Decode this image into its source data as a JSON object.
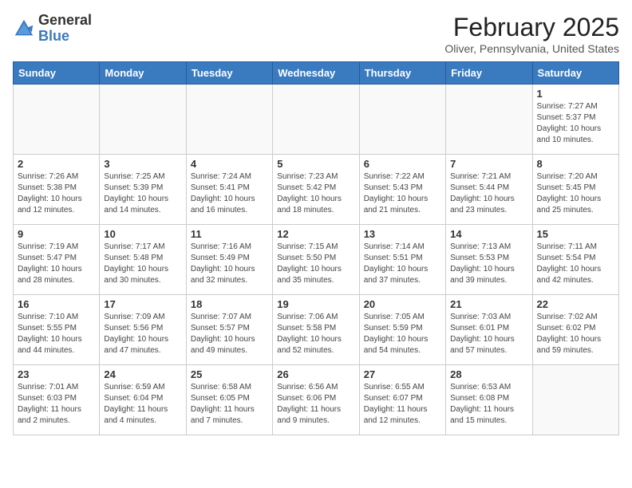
{
  "logo": {
    "general": "General",
    "blue": "Blue"
  },
  "header": {
    "month_year": "February 2025",
    "location": "Oliver, Pennsylvania, United States"
  },
  "weekdays": [
    "Sunday",
    "Monday",
    "Tuesday",
    "Wednesday",
    "Thursday",
    "Friday",
    "Saturday"
  ],
  "weeks": [
    [
      {
        "day": "",
        "info": ""
      },
      {
        "day": "",
        "info": ""
      },
      {
        "day": "",
        "info": ""
      },
      {
        "day": "",
        "info": ""
      },
      {
        "day": "",
        "info": ""
      },
      {
        "day": "",
        "info": ""
      },
      {
        "day": "1",
        "info": "Sunrise: 7:27 AM\nSunset: 5:37 PM\nDaylight: 10 hours\nand 10 minutes."
      }
    ],
    [
      {
        "day": "2",
        "info": "Sunrise: 7:26 AM\nSunset: 5:38 PM\nDaylight: 10 hours\nand 12 minutes."
      },
      {
        "day": "3",
        "info": "Sunrise: 7:25 AM\nSunset: 5:39 PM\nDaylight: 10 hours\nand 14 minutes."
      },
      {
        "day": "4",
        "info": "Sunrise: 7:24 AM\nSunset: 5:41 PM\nDaylight: 10 hours\nand 16 minutes."
      },
      {
        "day": "5",
        "info": "Sunrise: 7:23 AM\nSunset: 5:42 PM\nDaylight: 10 hours\nand 18 minutes."
      },
      {
        "day": "6",
        "info": "Sunrise: 7:22 AM\nSunset: 5:43 PM\nDaylight: 10 hours\nand 21 minutes."
      },
      {
        "day": "7",
        "info": "Sunrise: 7:21 AM\nSunset: 5:44 PM\nDaylight: 10 hours\nand 23 minutes."
      },
      {
        "day": "8",
        "info": "Sunrise: 7:20 AM\nSunset: 5:45 PM\nDaylight: 10 hours\nand 25 minutes."
      }
    ],
    [
      {
        "day": "9",
        "info": "Sunrise: 7:19 AM\nSunset: 5:47 PM\nDaylight: 10 hours\nand 28 minutes."
      },
      {
        "day": "10",
        "info": "Sunrise: 7:17 AM\nSunset: 5:48 PM\nDaylight: 10 hours\nand 30 minutes."
      },
      {
        "day": "11",
        "info": "Sunrise: 7:16 AM\nSunset: 5:49 PM\nDaylight: 10 hours\nand 32 minutes."
      },
      {
        "day": "12",
        "info": "Sunrise: 7:15 AM\nSunset: 5:50 PM\nDaylight: 10 hours\nand 35 minutes."
      },
      {
        "day": "13",
        "info": "Sunrise: 7:14 AM\nSunset: 5:51 PM\nDaylight: 10 hours\nand 37 minutes."
      },
      {
        "day": "14",
        "info": "Sunrise: 7:13 AM\nSunset: 5:53 PM\nDaylight: 10 hours\nand 39 minutes."
      },
      {
        "day": "15",
        "info": "Sunrise: 7:11 AM\nSunset: 5:54 PM\nDaylight: 10 hours\nand 42 minutes."
      }
    ],
    [
      {
        "day": "16",
        "info": "Sunrise: 7:10 AM\nSunset: 5:55 PM\nDaylight: 10 hours\nand 44 minutes."
      },
      {
        "day": "17",
        "info": "Sunrise: 7:09 AM\nSunset: 5:56 PM\nDaylight: 10 hours\nand 47 minutes."
      },
      {
        "day": "18",
        "info": "Sunrise: 7:07 AM\nSunset: 5:57 PM\nDaylight: 10 hours\nand 49 minutes."
      },
      {
        "day": "19",
        "info": "Sunrise: 7:06 AM\nSunset: 5:58 PM\nDaylight: 10 hours\nand 52 minutes."
      },
      {
        "day": "20",
        "info": "Sunrise: 7:05 AM\nSunset: 5:59 PM\nDaylight: 10 hours\nand 54 minutes."
      },
      {
        "day": "21",
        "info": "Sunrise: 7:03 AM\nSunset: 6:01 PM\nDaylight: 10 hours\nand 57 minutes."
      },
      {
        "day": "22",
        "info": "Sunrise: 7:02 AM\nSunset: 6:02 PM\nDaylight: 10 hours\nand 59 minutes."
      }
    ],
    [
      {
        "day": "23",
        "info": "Sunrise: 7:01 AM\nSunset: 6:03 PM\nDaylight: 11 hours\nand 2 minutes."
      },
      {
        "day": "24",
        "info": "Sunrise: 6:59 AM\nSunset: 6:04 PM\nDaylight: 11 hours\nand 4 minutes."
      },
      {
        "day": "25",
        "info": "Sunrise: 6:58 AM\nSunset: 6:05 PM\nDaylight: 11 hours\nand 7 minutes."
      },
      {
        "day": "26",
        "info": "Sunrise: 6:56 AM\nSunset: 6:06 PM\nDaylight: 11 hours\nand 9 minutes."
      },
      {
        "day": "27",
        "info": "Sunrise: 6:55 AM\nSunset: 6:07 PM\nDaylight: 11 hours\nand 12 minutes."
      },
      {
        "day": "28",
        "info": "Sunrise: 6:53 AM\nSunset: 6:08 PM\nDaylight: 11 hours\nand 15 minutes."
      },
      {
        "day": "",
        "info": ""
      }
    ]
  ]
}
